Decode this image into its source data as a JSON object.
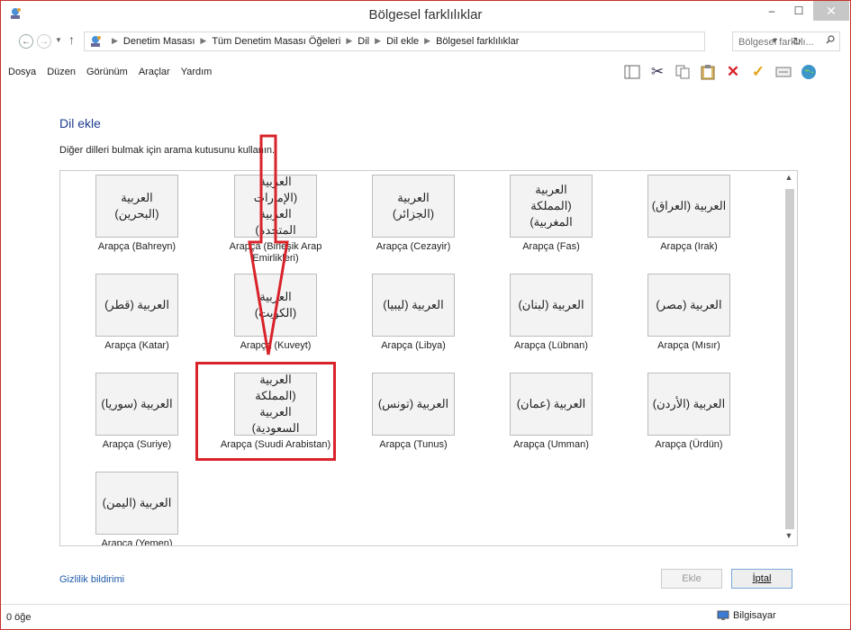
{
  "window": {
    "title": "Bölgesel farklılıklar",
    "controls": {
      "minimize": "–",
      "maximize": "☐",
      "close": "✕"
    }
  },
  "address": {
    "crumbs": [
      "Denetim Masası",
      "Tüm Denetim Masası Öğeleri",
      "Dil",
      "Dil ekle",
      "Bölgesel farklılıklar"
    ],
    "search_placeholder": "Bölgesel farklılı..."
  },
  "menu": [
    "Dosya",
    "Düzen",
    "Görünüm",
    "Araçlar",
    "Yardım"
  ],
  "toolbar_icons": [
    "panel-icon",
    "cut-icon",
    "copy-icon",
    "paste-icon",
    "delete-icon",
    "checkmark-icon",
    "properties-icon",
    "globe-icon"
  ],
  "page": {
    "heading": "Dil ekle",
    "subtext": "Diğer dilleri bulmak için arama kutusunu kullanın."
  },
  "languages": [
    {
      "native": "العربية (البحرين)",
      "label": "Arapça (Bahreyn)"
    },
    {
      "native": "العربية (الإمارات العربية المتحدة)",
      "label": "Arapça (Birleşik Arap Emirlikleri)"
    },
    {
      "native": "العربية (الجزائر)",
      "label": "Arapça (Cezayir)"
    },
    {
      "native": "العربية (المملكة المغربية)",
      "label": "Arapça (Fas)"
    },
    {
      "native": "العربية (العراق)",
      "label": "Arapça (Irak)"
    },
    {
      "native": "العربية (قطر)",
      "label": "Arapça (Katar)"
    },
    {
      "native": "العربية (الكويت)",
      "label": "Arapça (Kuveyt)"
    },
    {
      "native": "العربية (ليبيا)",
      "label": "Arapça (Libya)"
    },
    {
      "native": "العربية (لبنان)",
      "label": "Arapça (Lübnan)"
    },
    {
      "native": "العربية (مصر)",
      "label": "Arapça (Mısır)"
    },
    {
      "native": "العربية (سوريا)",
      "label": "Arapça (Suriye)"
    },
    {
      "native": "العربية (المملكة العربية السعودية)",
      "label": "Arapça (Suudi Arabistan)"
    },
    {
      "native": "العربية (تونس)",
      "label": "Arapça (Tunus)"
    },
    {
      "native": "العربية (عمان)",
      "label": "Arapça (Umman)"
    },
    {
      "native": "العربية (الأردن)",
      "label": "Arapça (Ürdün)"
    },
    {
      "native": "العربية (اليمن)",
      "label": "Arapça (Yemen)"
    }
  ],
  "footer": {
    "privacy": "Gizlilik bildirimi",
    "add": "Ekle",
    "cancel": "İptal"
  },
  "status": {
    "items": "0 öğe",
    "computer": "Bilgisayar"
  },
  "colors": {
    "annotation": "#d9232a",
    "heading": "#1e3d8f",
    "link": "#1e5aa8"
  }
}
